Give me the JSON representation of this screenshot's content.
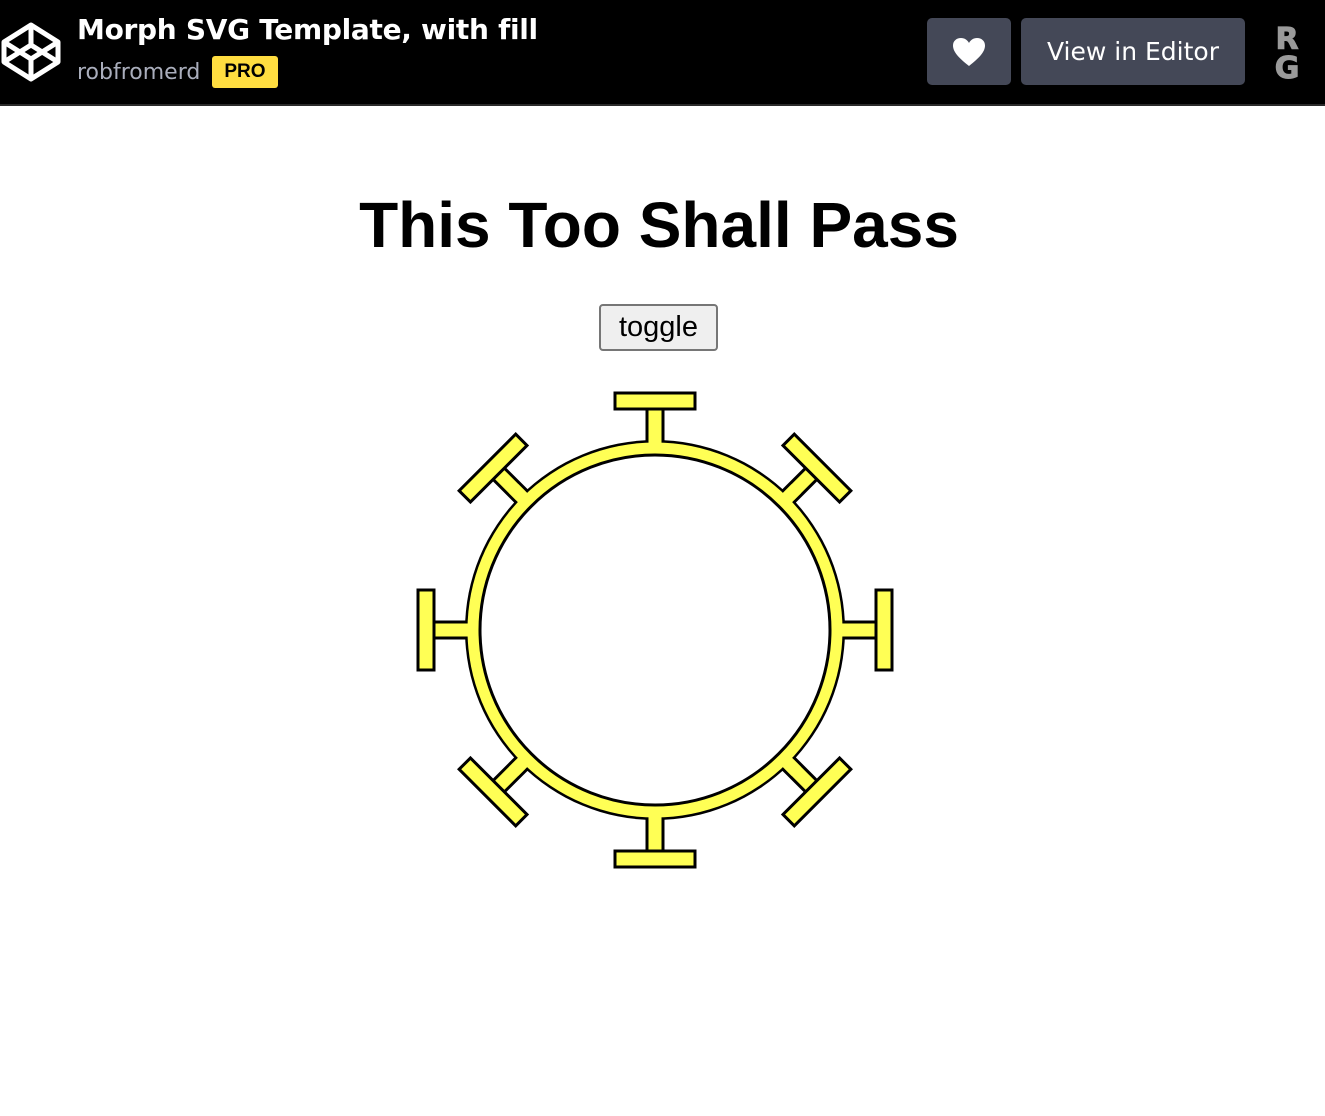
{
  "header": {
    "pen_title": "Morph SVG Template, with fill",
    "author": "robfromerd",
    "badge": "PRO",
    "view_editor_label": "View in Editor",
    "avatar_letters": "R G"
  },
  "main": {
    "headline": "This Too Shall Pass",
    "toggle_label": "toggle"
  },
  "colors": {
    "topbar": "#000000",
    "button_bg": "#444857",
    "badge": "#ffdd40",
    "shape_fill": "#ffff55",
    "shape_stroke": "#000000"
  },
  "icons": {
    "logo": "codepen-logo-icon",
    "like": "heart-icon",
    "avatar": "avatar"
  }
}
